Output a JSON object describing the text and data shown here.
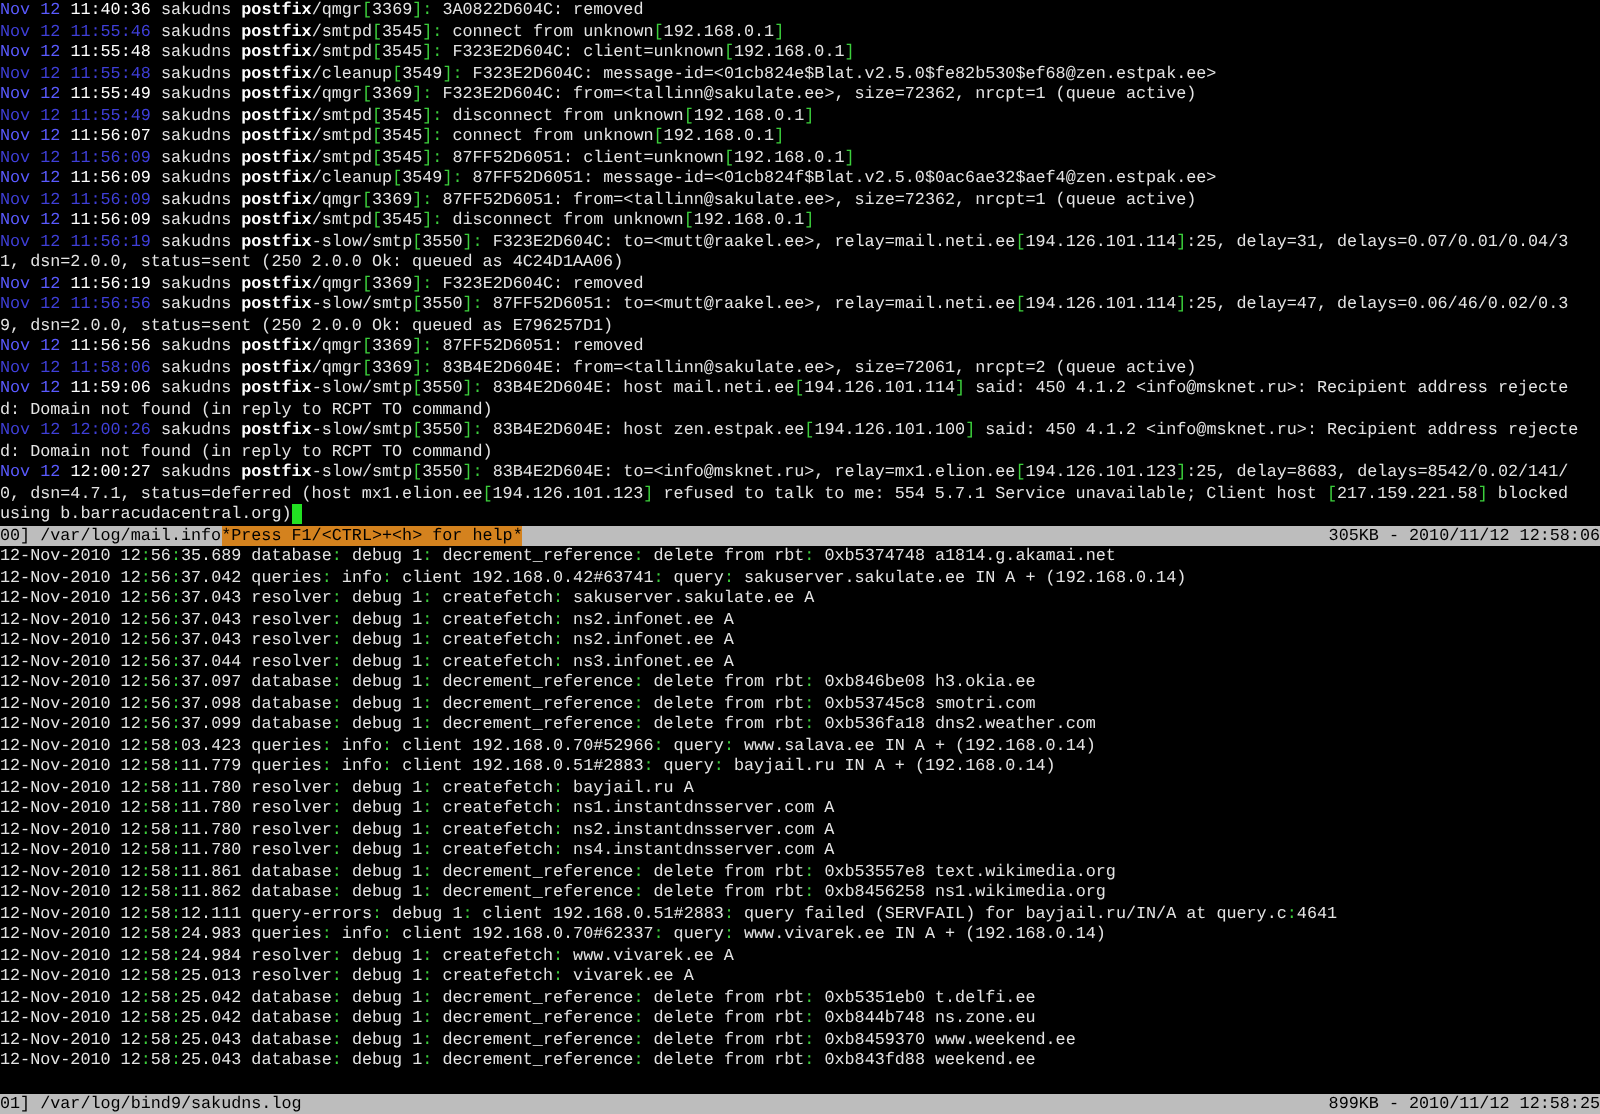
{
  "mail_pane": {
    "lines": [
      {
        "date": "Nov 12",
        "time": "11:40:36",
        "dim": false,
        "host": "sakudns",
        "program": "postfix",
        "process": "/qmgr",
        "pid": "[3369]:",
        "message": "3A0822D604C: removed"
      },
      {
        "date": "Nov 12",
        "time": "11:55:46",
        "dim": true,
        "host": "sakudns",
        "program": "postfix",
        "process": "/smtpd",
        "pid": "[3545]:",
        "message": "connect from unknown[192.168.0.1]"
      },
      {
        "date": "Nov 12",
        "time": "11:55:48",
        "dim": false,
        "host": "sakudns",
        "program": "postfix",
        "process": "/smtpd",
        "pid": "[3545]:",
        "message": "F323E2D604C: client=unknown[192.168.0.1]"
      },
      {
        "date": "Nov 12",
        "time": "11:55:48",
        "dim": true,
        "host": "sakudns",
        "program": "postfix",
        "process": "/cleanup",
        "pid": "[3549]:",
        "message": "F323E2D604C: message-id=<01cb824e$Blat.v2.5.0$fe82b530$ef68@zen.estpak.ee>"
      },
      {
        "date": "Nov 12",
        "time": "11:55:49",
        "dim": false,
        "host": "sakudns",
        "program": "postfix",
        "process": "/qmgr",
        "pid": "[3369]:",
        "message": "F323E2D604C: from=<tallinn@sakulate.ee>, size=72362, nrcpt=1 (queue active)"
      },
      {
        "date": "Nov 12",
        "time": "11:55:49",
        "dim": true,
        "host": "sakudns",
        "program": "postfix",
        "process": "/smtpd",
        "pid": "[3545]:",
        "message": "disconnect from unknown[192.168.0.1]"
      },
      {
        "date": "Nov 12",
        "time": "11:56:07",
        "dim": false,
        "host": "sakudns",
        "program": "postfix",
        "process": "/smtpd",
        "pid": "[3545]:",
        "message": "connect from unknown[192.168.0.1]"
      },
      {
        "date": "Nov 12",
        "time": "11:56:09",
        "dim": true,
        "host": "sakudns",
        "program": "postfix",
        "process": "/smtpd",
        "pid": "[3545]:",
        "message": "87FF52D6051: client=unknown[192.168.0.1]"
      },
      {
        "date": "Nov 12",
        "time": "11:56:09",
        "dim": false,
        "host": "sakudns",
        "program": "postfix",
        "process": "/cleanup",
        "pid": "[3549]:",
        "message": "87FF52D6051: message-id=<01cb824f$Blat.v2.5.0$0ac6ae32$aef4@zen.estpak.ee>"
      },
      {
        "date": "Nov 12",
        "time": "11:56:09",
        "dim": true,
        "host": "sakudns",
        "program": "postfix",
        "process": "/qmgr",
        "pid": "[3369]:",
        "message": "87FF52D6051: from=<tallinn@sakulate.ee>, size=72362, nrcpt=1 (queue active)"
      },
      {
        "date": "Nov 12",
        "time": "11:56:09",
        "dim": false,
        "host": "sakudns",
        "program": "postfix",
        "process": "/smtpd",
        "pid": "[3545]:",
        "message": "disconnect from unknown[192.168.0.1]"
      },
      {
        "date": "Nov 12",
        "time": "11:56:19",
        "dim": true,
        "host": "sakudns",
        "program": "postfix",
        "process": "-slow/smtp",
        "pid": "[3550]:",
        "message": "F323E2D604C: to=<mutt@raakel.ee>, relay=mail.neti.ee[194.126.101.114]:25, delay=31, delays=0.07/0.01/0.04/31, dsn=2.0.0, status=sent (250 2.0.0 Ok: queued as 4C24D1AA06)"
      },
      {
        "date": "Nov 12",
        "time": "11:56:19",
        "dim": false,
        "host": "sakudns",
        "program": "postfix",
        "process": "/qmgr",
        "pid": "[3369]:",
        "message": "F323E2D604C: removed"
      },
      {
        "date": "Nov 12",
        "time": "11:56:56",
        "dim": true,
        "host": "sakudns",
        "program": "postfix",
        "process": "-slow/smtp",
        "pid": "[3550]:",
        "message": "87FF52D6051: to=<mutt@raakel.ee>, relay=mail.neti.ee[194.126.101.114]:25, delay=47, delays=0.06/46/0.02/0.39, dsn=2.0.0, status=sent (250 2.0.0 Ok: queued as E796257D1)"
      },
      {
        "date": "Nov 12",
        "time": "11:56:56",
        "dim": false,
        "host": "sakudns",
        "program": "postfix",
        "process": "/qmgr",
        "pid": "[3369]:",
        "message": "87FF52D6051: removed"
      },
      {
        "date": "Nov 12",
        "time": "11:58:06",
        "dim": true,
        "host": "sakudns",
        "program": "postfix",
        "process": "/qmgr",
        "pid": "[3369]:",
        "message": "83B4E2D604E: from=<tallinn@sakulate.ee>, size=72061, nrcpt=2 (queue active)"
      },
      {
        "date": "Nov 12",
        "time": "11:59:06",
        "dim": false,
        "host": "sakudns",
        "program": "postfix",
        "process": "-slow/smtp",
        "pid": "[3550]:",
        "message": "83B4E2D604E: host mail.neti.ee[194.126.101.114] said: 450 4.1.2 <info@msknet.ru>: Recipient address rejected: Domain not found (in reply to RCPT TO command)"
      },
      {
        "date": "Nov 12",
        "time": "12:00:26",
        "dim": true,
        "host": "sakudns",
        "program": "postfix",
        "process": "-slow/smtp",
        "pid": "[3550]:",
        "message": "83B4E2D604E: host zen.estpak.ee[194.126.101.100] said: 450 4.1.2 <info@msknet.ru>: Recipient address rejected: Domain not found (in reply to RCPT TO command)"
      },
      {
        "date": "Nov 12",
        "time": "12:00:27",
        "dim": false,
        "host": "sakudns",
        "program": "postfix",
        "process": "-slow/smtp",
        "pid": "[3550]:",
        "message": "83B4E2D604E: to=<info@msknet.ru>, relay=mx1.elion.ee[194.126.101.123]:25, delay=8683, delays=8542/0.02/141/0, dsn=4.7.1, status=deferred (host mx1.elion.ee[194.126.101.123] refused to talk to me: 554 5.7.1 Service unavailable; Client host [217.159.221.58] blocked using b.barracudacentral.org)"
      }
    ],
    "status_bar": {
      "file": "00] /var/log/mail.info",
      "help": "*Press F1/<CTRL>+<h> for help*",
      "info": "305KB - 2010/11/12 12:58:06"
    }
  },
  "bind_pane": {
    "lines": [
      "12-Nov-2010 12:56:35.689 database: debug 1: decrement_reference: delete from rbt: 0xb5374748 a1814.g.akamai.net",
      "12-Nov-2010 12:56:37.042 queries: info: client 192.168.0.42#63741: query: sakuserver.sakulate.ee IN A + (192.168.0.14)",
      "12-Nov-2010 12:56:37.043 resolver: debug 1: createfetch: sakuserver.sakulate.ee A",
      "12-Nov-2010 12:56:37.043 resolver: debug 1: createfetch: ns2.infonet.ee A",
      "12-Nov-2010 12:56:37.043 resolver: debug 1: createfetch: ns2.infonet.ee A",
      "12-Nov-2010 12:56:37.044 resolver: debug 1: createfetch: ns3.infonet.ee A",
      "12-Nov-2010 12:56:37.097 database: debug 1: decrement_reference: delete from rbt: 0xb846be08 h3.okia.ee",
      "12-Nov-2010 12:56:37.098 database: debug 1: decrement_reference: delete from rbt: 0xb53745c8 smotri.com",
      "12-Nov-2010 12:56:37.099 database: debug 1: decrement_reference: delete from rbt: 0xb536fa18 dns2.weather.com",
      "12-Nov-2010 12:58:03.423 queries: info: client 192.168.0.70#52966: query: www.salava.ee IN A + (192.168.0.14)",
      "12-Nov-2010 12:58:11.779 queries: info: client 192.168.0.51#2883: query: bayjail.ru IN A + (192.168.0.14)",
      "12-Nov-2010 12:58:11.780 resolver: debug 1: createfetch: bayjail.ru A",
      "12-Nov-2010 12:58:11.780 resolver: debug 1: createfetch: ns1.instantdnsserver.com A",
      "12-Nov-2010 12:58:11.780 resolver: debug 1: createfetch: ns2.instantdnsserver.com A",
      "12-Nov-2010 12:58:11.780 resolver: debug 1: createfetch: ns4.instantdnsserver.com A",
      "12-Nov-2010 12:58:11.861 database: debug 1: decrement_reference: delete from rbt: 0xb53557e8 text.wikimedia.org",
      "12-Nov-2010 12:58:11.862 database: debug 1: decrement_reference: delete from rbt: 0xb8456258 ns1.wikimedia.org",
      "12-Nov-2010 12:58:12.111 query-errors: debug 1: client 192.168.0.51#2883: query failed (SERVFAIL) for bayjail.ru/IN/A at query.c:4641",
      "12-Nov-2010 12:58:24.983 queries: info: client 192.168.0.70#62337: query: www.vivarek.ee IN A + (192.168.0.14)",
      "12-Nov-2010 12:58:24.984 resolver: debug 1: createfetch: www.vivarek.ee A",
      "12-Nov-2010 12:58:25.013 resolver: debug 1: createfetch: vivarek.ee A",
      "12-Nov-2010 12:58:25.042 database: debug 1: decrement_reference: delete from rbt: 0xb5351eb0 t.delfi.ee",
      "12-Nov-2010 12:58:25.042 database: debug 1: decrement_reference: delete from rbt: 0xb844b748 ns.zone.eu",
      "12-Nov-2010 12:58:25.043 database: debug 1: decrement_reference: delete from rbt: 0xb8459370 www.weekend.ee",
      "12-Nov-2010 12:58:25.043 database: debug 1: decrement_reference: delete from rbt: 0xb843fd88 weekend.ee"
    ],
    "status_bar": {
      "file": "01] /var/log/bind9/sakudns.log",
      "info": "899KB - 2010/11/12 12:58:25"
    }
  }
}
